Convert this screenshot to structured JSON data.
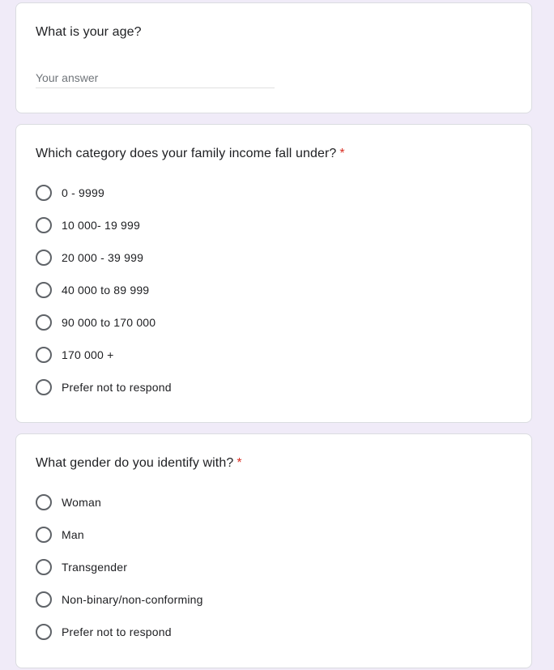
{
  "age_question": {
    "title": "What is your age?",
    "answer_placeholder": "Your answer",
    "answer_value": ""
  },
  "income_question": {
    "title": "Which category does your family income fall under?",
    "required_marker": "*",
    "options": [
      {
        "label": "0 - 9999"
      },
      {
        "label": "10 000- 19 999"
      },
      {
        "label": "20 000 - 39 999"
      },
      {
        "label": "40 000 to 89 999"
      },
      {
        "label": "90 000 to 170 000"
      },
      {
        "label": "170 000 +"
      },
      {
        "label": "Prefer not to respond"
      }
    ]
  },
  "gender_question": {
    "title": "What gender do you identify with?",
    "required_marker": "*",
    "options": [
      {
        "label": "Woman"
      },
      {
        "label": "Man"
      },
      {
        "label": "Transgender"
      },
      {
        "label": "Non-binary/non-conforming"
      },
      {
        "label": "Prefer not to respond"
      }
    ]
  },
  "colors": {
    "background": "#f0ebf8",
    "card": "#ffffff",
    "required": "#d93025",
    "radio_border": "#5f6368"
  }
}
